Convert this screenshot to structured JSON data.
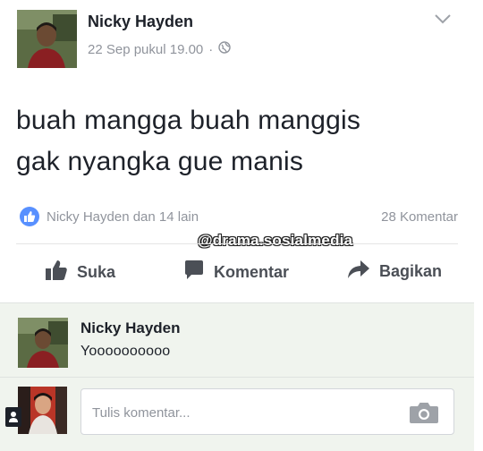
{
  "post": {
    "author": "Nicky Hayden",
    "time": "22 Sep pukul 19.00",
    "separator": "·",
    "audience_icon": "globe-icon",
    "text_line1": "buah mangga buah manggis",
    "text_line2": "gak nyangka gue manis"
  },
  "reactions": {
    "names": "Nicky Hayden dan 14 lain",
    "comment_count": "28 Komentar"
  },
  "watermark": "@drama.sosialmedia",
  "actions": {
    "like_label": "Suka",
    "comment_label": "Komentar",
    "share_label": "Bagikan"
  },
  "comment": {
    "author": "Nicky Hayden",
    "text": "Yoooooooooo"
  },
  "composer": {
    "placeholder": "Tulis komentar..."
  },
  "colors": {
    "facebook_blue": "#5890ff",
    "action_gray": "#4b4f56",
    "meta_gray": "#90949c",
    "comment_bg": "#f0f4ee"
  }
}
